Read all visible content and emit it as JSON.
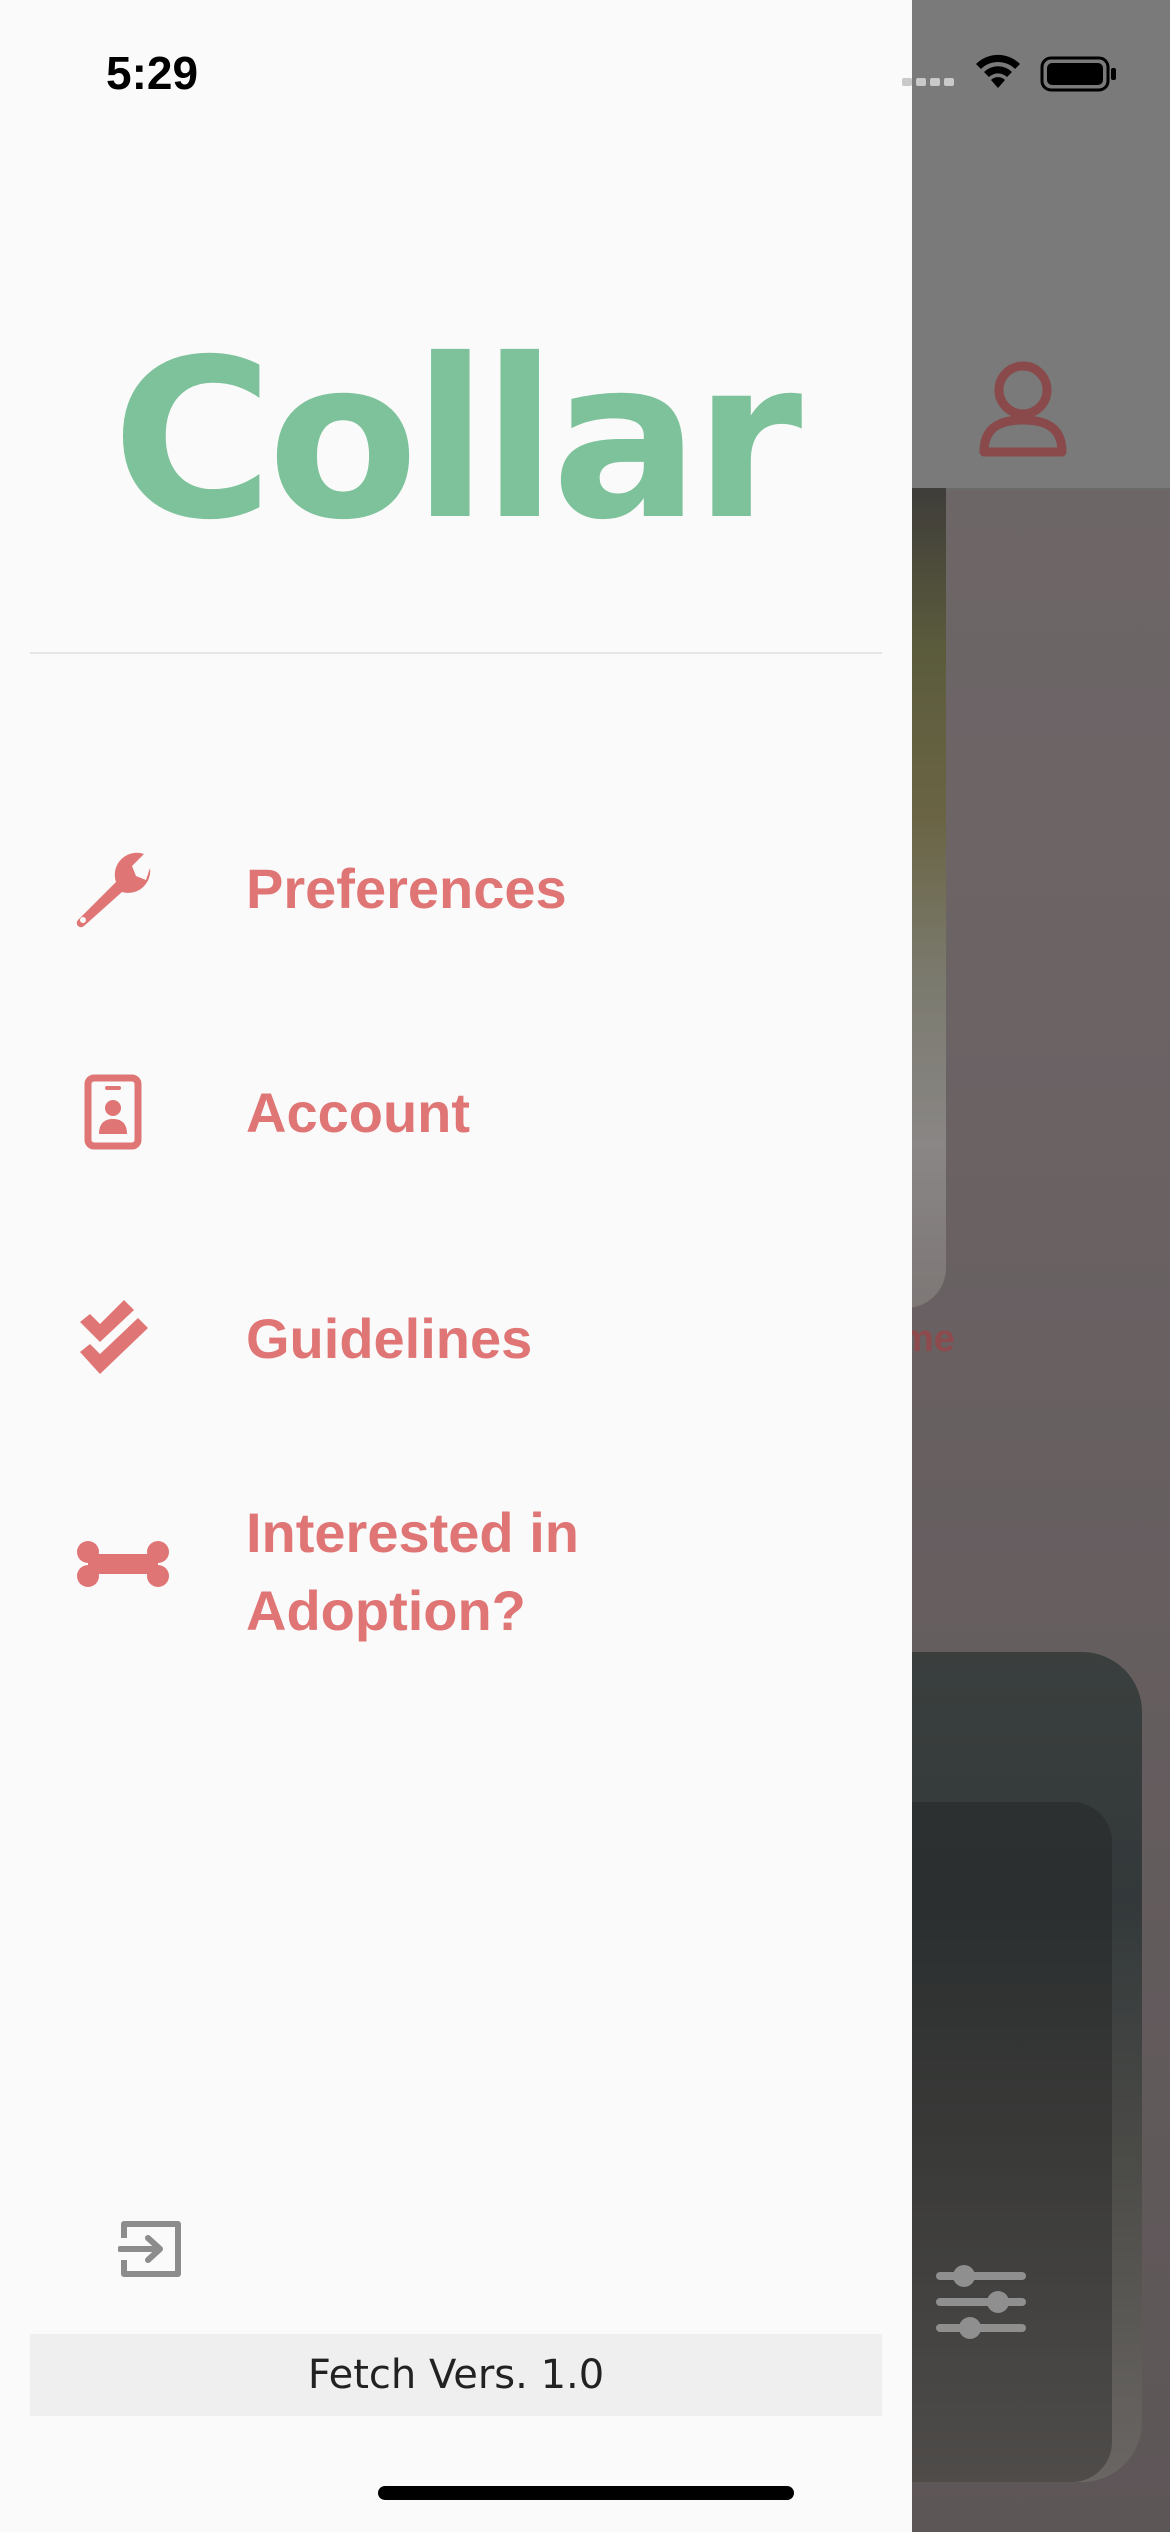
{
  "status_bar": {
    "time": "5:29"
  },
  "drawer": {
    "logo_text": "Collar",
    "menu": [
      {
        "label": "Preferences",
        "icon": "wrench-icon"
      },
      {
        "label": "Account",
        "icon": "id-badge-icon"
      },
      {
        "label": "Guidelines",
        "icon": "double-check-icon"
      },
      {
        "label_line1": "Interested in",
        "label_line2": "Adoption?",
        "icon": "bone-icon"
      }
    ],
    "signout_icon": "sign-out-icon",
    "version": "Fetch Vers. 1.0"
  },
  "background": {
    "card_caption": "me",
    "profile_icon": "user-icon",
    "filter_icon": "sliders-icon"
  },
  "colors": {
    "accent": "#e07575",
    "logo": "#7dc29b",
    "drawer_bg": "#fafafa"
  }
}
